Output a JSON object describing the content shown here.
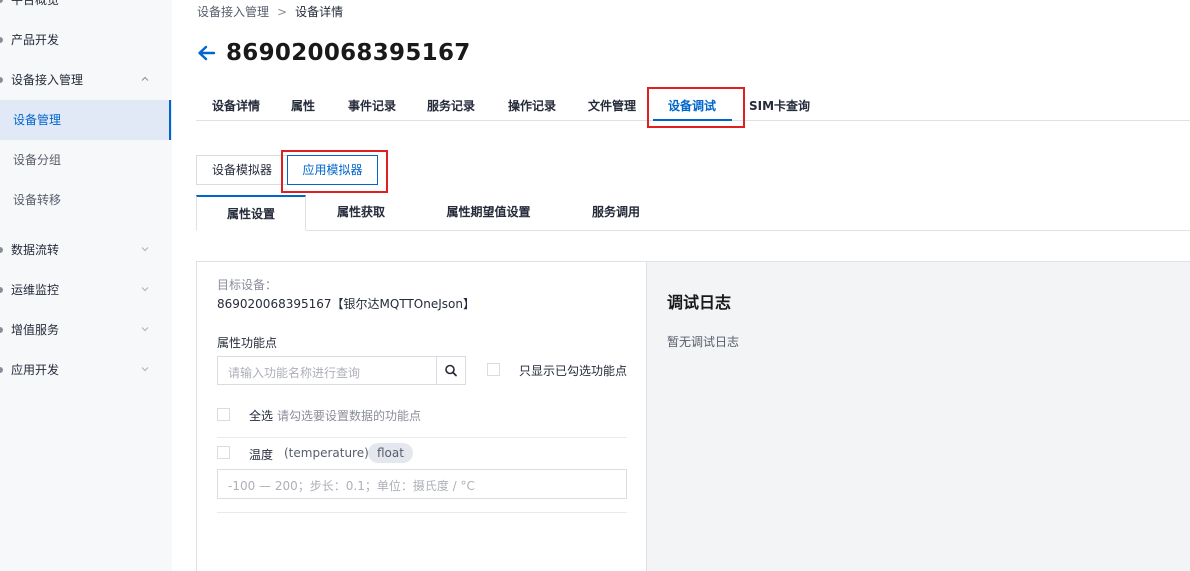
{
  "sidebar": {
    "items": [
      {
        "label": "平台概览"
      },
      {
        "label": "产品开发"
      },
      {
        "label": "设备接入管理"
      },
      {
        "label": "设备管理"
      },
      {
        "label": "设备分组"
      },
      {
        "label": "设备转移"
      },
      {
        "label": "数据流转"
      },
      {
        "label": "运维监控"
      },
      {
        "label": "增值服务"
      },
      {
        "label": "应用开发"
      }
    ]
  },
  "breadcrumb": {
    "parent": "设备接入管理",
    "separator": ">",
    "current": "设备详情"
  },
  "device": {
    "id": "869020068395167"
  },
  "tabs": [
    "设备详情",
    "属性",
    "事件记录",
    "服务记录",
    "操作记录",
    "文件管理",
    "设备调试",
    "SIM卡查询"
  ],
  "simulator_tabs": [
    "设备模拟器",
    "应用模拟器"
  ],
  "property_tabs": [
    "属性设置",
    "属性获取",
    "属性期望值设置",
    "服务调用"
  ],
  "left_panel": {
    "target_label": "目标设备：",
    "target_value": "869020068395167【银尔达MQTTOneJson】",
    "feature_label": "属性功能点",
    "search_placeholder": "请输入功能名称进行查询",
    "show_selected_label": "只显示已勾选功能点",
    "select_all_label": "全选",
    "select_all_hint": "请勾选要设置数据的功能点",
    "property": {
      "name": "温度",
      "identifier": "(temperature)",
      "type": "float"
    },
    "value_placeholder": "-100 — 200；步长：0.1；单位：摄氏度 / °C"
  },
  "right_panel": {
    "title": "调试日志",
    "empty_text": "暂无调试日志"
  },
  "colors": {
    "accent": "#0066cc",
    "highlight": "#e02020",
    "sidebar_bg": "#f7f8fa",
    "log_bg": "#f3f4f6"
  }
}
